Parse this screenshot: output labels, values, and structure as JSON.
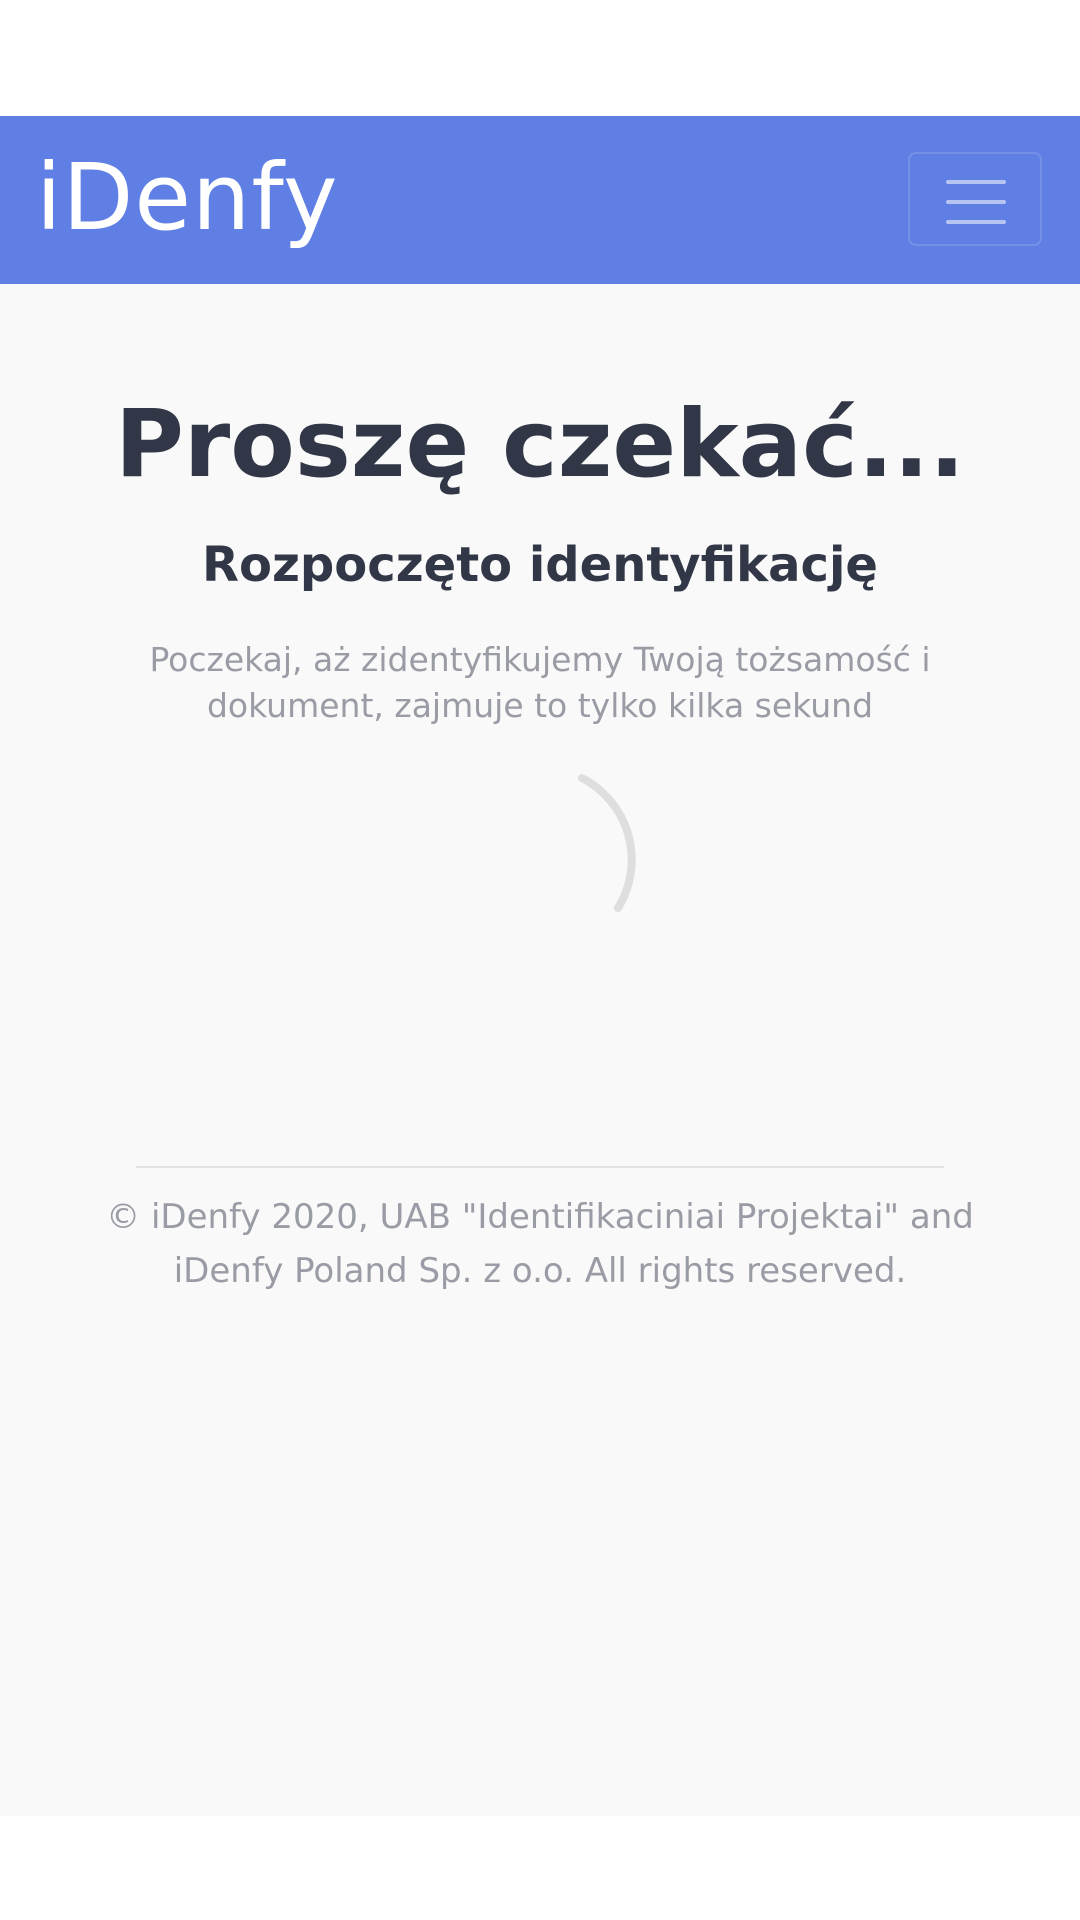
{
  "header": {
    "logo_text": "iDenfy",
    "menu_icon": "hamburger-menu-icon",
    "background_color": "#5f7fe4"
  },
  "main": {
    "title": "Proszę czekać...",
    "subtitle": "Rozpoczęto identyfikację",
    "description": "Poczekaj, aż zidentyfikujemy Twoją tożsamość i dokument, zajmuje to tylko kilka sekund",
    "spinner_icon": "loading-spinner-icon"
  },
  "footer": {
    "copyright": "© iDenfy 2020, UAB \"Identifikaciniai Projektai\" and iDenfy Poland Sp. z o.o. All rights reserved."
  },
  "colors": {
    "heading_text": "#323747",
    "muted_text": "#9a9ca5",
    "page_background": "#f9f9f9"
  }
}
